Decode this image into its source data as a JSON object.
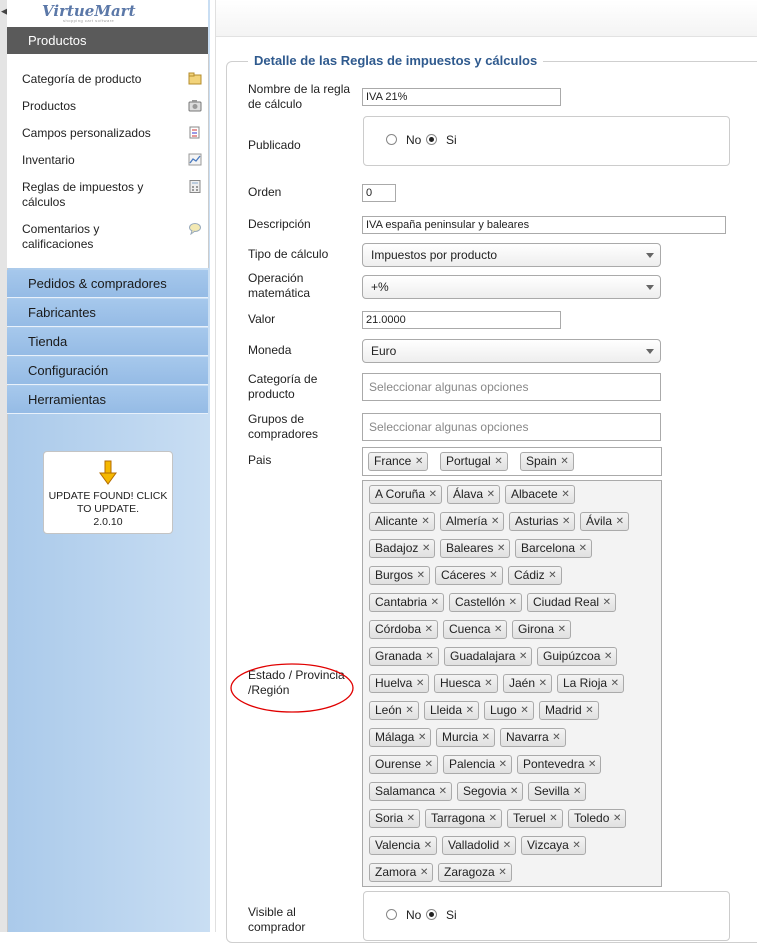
{
  "sidebar": {
    "logo": "VirtueMart",
    "logo_sub": "shopping cart software",
    "section": "Productos",
    "items": [
      {
        "label": "Categoría de producto",
        "icon": "folder-icon"
      },
      {
        "label": "Productos",
        "icon": "camera-icon"
      },
      {
        "label": "Campos personalizados",
        "icon": "custom-fields-icon"
      },
      {
        "label": "Inventario",
        "icon": "chart-icon"
      },
      {
        "label": "Reglas de impuestos y cálculos",
        "icon": "calculator-icon"
      },
      {
        "label": "Comentarios y calificaciones",
        "icon": "comment-icon"
      }
    ],
    "nav": [
      "Pedidos & compradores",
      "Fabricantes",
      "Tienda",
      "Configuración",
      "Herramientas"
    ],
    "update": {
      "line1": "UPDATE FOUND! CLICK",
      "line2": "TO UPDATE.",
      "version": "2.0.10"
    }
  },
  "form": {
    "legend": "Detalle de las Reglas de impuestos y cálculos",
    "labels": {
      "nombre": "Nombre de la regla de cálculo",
      "publicado": "Publicado",
      "orden": "Orden",
      "descripcion": "Descripción",
      "tipo": "Tipo de cálculo",
      "operacion": "Operación matemática",
      "valor": "Valor",
      "moneda": "Moneda",
      "categoria": "Categoría de producto",
      "grupos": "Grupos de compradores",
      "pais": "Pais",
      "estado": "Estado / Provincia /Región",
      "visible": "Visible al comprador"
    },
    "values": {
      "nombre": "IVA 21%",
      "orden": "0",
      "descripcion": "IVA españa peninsular y baleares",
      "tipo": "Impuestos por producto",
      "operacion": "+%",
      "valor": "21.0000",
      "moneda": "Euro"
    },
    "radio": {
      "no": "No",
      "si": "Si",
      "publicado_selected": "Si",
      "visible_selected": "Si"
    },
    "placeholder": "Seleccionar algunas opciones",
    "countries": [
      "France",
      "Portugal",
      "Spain"
    ],
    "regions": [
      [
        "A Coruña",
        "Álava",
        "Albacete"
      ],
      [
        "Alicante",
        "Almería",
        "Asturias",
        "Ávila"
      ],
      [
        "Badajoz",
        "Baleares",
        "Barcelona"
      ],
      [
        "Burgos",
        "Cáceres",
        "Cádiz"
      ],
      [
        "Cantabria",
        "Castellón",
        "Ciudad Real"
      ],
      [
        "Córdoba",
        "Cuenca",
        "Girona"
      ],
      [
        "Granada",
        "Guadalajara",
        "Guipúzcoa"
      ],
      [
        "Huelva",
        "Huesca",
        "Jaén",
        "La Rioja"
      ],
      [
        "León",
        "Lleida",
        "Lugo",
        "Madrid"
      ],
      [
        "Málaga",
        "Murcia",
        "Navarra"
      ],
      [
        "Ourense",
        "Palencia",
        "Pontevedra"
      ],
      [
        "Salamanca",
        "Segovia",
        "Sevilla"
      ],
      [
        "Soria",
        "Tarragona",
        "Teruel",
        "Toledo"
      ],
      [
        "Valencia",
        "Valladolid",
        "Vizcaya"
      ],
      [
        "Zamora",
        "Zaragoza"
      ]
    ]
  },
  "colors": {
    "legend": "#2f5a8e",
    "sidebar": "#a9c9ea",
    "annotation": "#e00000"
  }
}
